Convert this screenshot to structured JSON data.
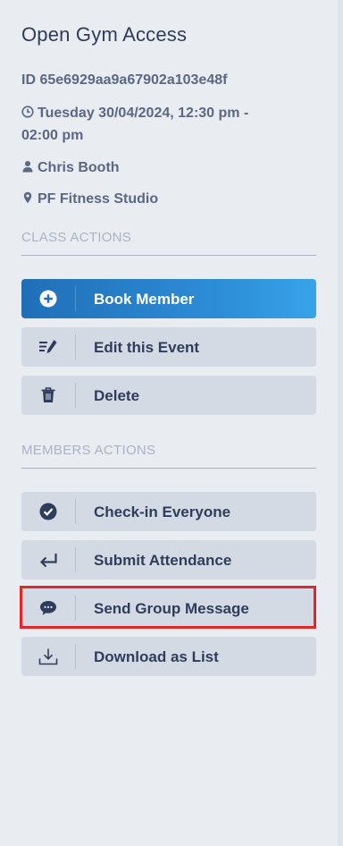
{
  "event": {
    "title": "Open Gym Access",
    "id": "ID 65e6929aa9a67902a103e48f",
    "datetime_line1": "Tuesday 30/04/2024, 12:30 pm -",
    "datetime_line2": "02:00 pm",
    "instructor": "Chris Booth",
    "location": "PF Fitness Studio"
  },
  "class_actions": {
    "heading": "CLASS ACTIONS",
    "buttons": [
      {
        "label": "Book Member",
        "icon": "plus-circle-icon"
      },
      {
        "label": "Edit this Event",
        "icon": "edit-icon"
      },
      {
        "label": "Delete",
        "icon": "trash-icon"
      }
    ]
  },
  "members_actions": {
    "heading": "MEMBERS ACTIONS",
    "buttons": [
      {
        "label": "Check-in Everyone",
        "icon": "check-circle-icon"
      },
      {
        "label": "Submit Attendance",
        "icon": "enter-arrow-icon"
      },
      {
        "label": "Send Group Message",
        "icon": "chat-bubble-icon"
      },
      {
        "label": "Download as List",
        "icon": "download-icon"
      }
    ]
  },
  "colors": {
    "primary_gradient_start": "#1f6fb8",
    "primary_gradient_end": "#38a3ea",
    "highlight": "#e52628",
    "background": "#e9ecf1",
    "button_bg": "#d3dae3"
  }
}
